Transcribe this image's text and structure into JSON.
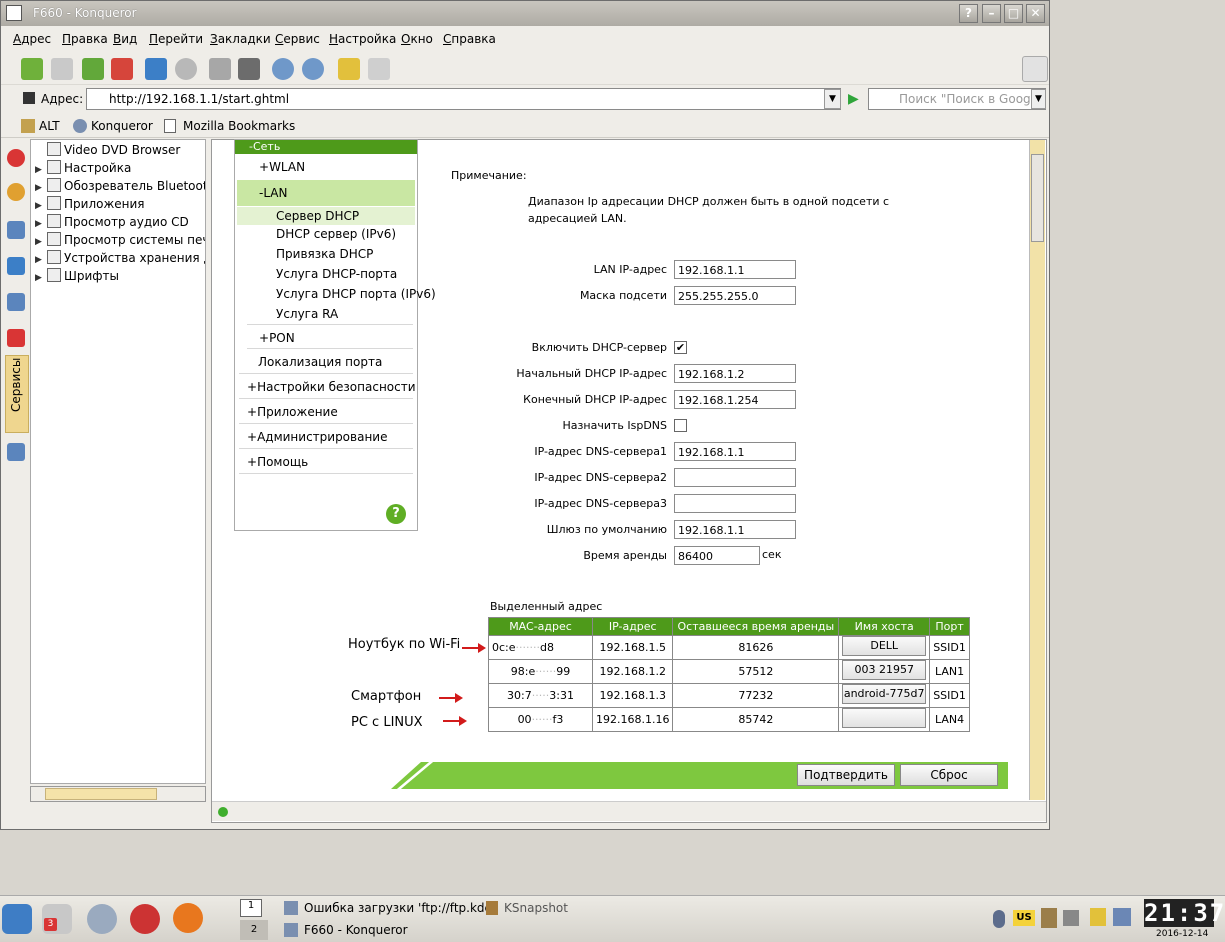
{
  "window": {
    "title": "F660 - Konqueror",
    "buttons": [
      "?",
      "–",
      "□",
      "✕"
    ]
  },
  "menu": [
    "Адрес",
    "Правка",
    "Вид",
    "Перейти",
    "Закладки",
    "Сервис",
    "Настройка",
    "Окно",
    "Справка"
  ],
  "address": {
    "label": "Адрес:",
    "url": "http://192.168.1.1/start.ghtml",
    "search_placeholder": "Поиск \"Поиск в Google\""
  },
  "bookmarks": [
    "ALT",
    "Konqueror",
    "Mozilla Bookmarks"
  ],
  "sidebar": {
    "services_tab": "Сервисы",
    "tree": [
      "Video DVD Browser",
      "Настройка",
      "Обозреватель Bluetooth",
      "Приложения",
      "Просмотр аудио CD",
      "Просмотр системы печат",
      "Устройства хранения дан",
      "Шрифты"
    ]
  },
  "router_nav": {
    "top": "-Сеть",
    "wlan": "WLAN",
    "lan": "LAN",
    "lan_items": [
      "Сервер DHCP",
      "DHCP сервер (IPv6)",
      "Привязка DHCP",
      "Услуга DHCP-порта",
      "Услуга DHCP порта (IPv6)",
      "Услуга RA"
    ],
    "pon": "PON",
    "port_loc": "Локализация порта",
    "sections": [
      "Настройки безопасности",
      "Приложение",
      "Администрирование",
      "Помощь"
    ],
    "help": "?"
  },
  "note": {
    "title": "Примечание:",
    "text": "Диапазон Ip адресации DHCP должен быть в одной подсети с адресацией LAN."
  },
  "form": {
    "lan_ip_label": "LAN IP-адрес",
    "lan_ip": "192.168.1.1",
    "mask_label": "Маска подсети",
    "mask": "255.255.255.0",
    "dhcp_enable_label": "Включить DHCP-сервер",
    "dhcp_enable_mark": "✔",
    "start_ip_label": "Начальный DHCP IP-адрес",
    "start_ip": "192.168.1.2",
    "end_ip_label": "Конечный DHCP IP-адрес",
    "end_ip": "192.168.1.254",
    "ispdns_label": "Назначить IspDNS",
    "dns1_label": "IP-адрес DNS-сервера1",
    "dns1": "192.168.1.1",
    "dns2_label": "IP-адрес DNS-сервера2",
    "dns2": "",
    "dns3_label": "IP-адрес DNS-сервера3",
    "dns3": "",
    "gateway_label": "Шлюз по умолчанию",
    "gateway": "192.168.1.1",
    "lease_label": "Время аренды",
    "lease": "86400",
    "lease_unit": "сек"
  },
  "leases": {
    "title": "Выделенный адрес",
    "headers": [
      "MAC-адрес",
      "IP-адрес",
      "Оставшееся время аренды",
      "Имя хоста",
      "Порт"
    ],
    "rows": [
      {
        "mac_a": "0c:e",
        "mac_b": "d8",
        "ip": "192.168.1.5",
        "left": "81626",
        "host": "DELL",
        "port": "SSID1"
      },
      {
        "mac_a": "98:e",
        "mac_b": "99",
        "ip": "192.168.1.2",
        "left": "57512",
        "host": "003      21957",
        "port": "LAN1"
      },
      {
        "mac_a": "30:7",
        "mac_b": "3:31",
        "ip": "192.168.1.3",
        "left": "77232",
        "host": "android-775d7",
        "port": "SSID1"
      },
      {
        "mac_a": "00",
        "mac_b": "f3",
        "ip": "192.168.1.16",
        "left": "85742",
        "host": "",
        "port": "LAN4"
      }
    ]
  },
  "annotations": {
    "wifi": "Ноутбук по Wi-Fi",
    "phone": "Смартфон",
    "pc": "PC с LINUX"
  },
  "buttons": {
    "confirm": "Подтвердить",
    "reset": "Сброс"
  },
  "taskbar": {
    "task1": "Ошибка загрузки 'ftp://ftp.kde",
    "task2": "KSnapshot",
    "task3": "F660 - Konqueror",
    "desk1": "1",
    "desk2": "2",
    "badge": "3",
    "layout": "US",
    "clock": "21:37",
    "date": "2016-12-14"
  },
  "colors": {
    "router_green": "#4e9a1a",
    "bar_green": "#7ec83f",
    "annotation_red": "#d21b1b"
  }
}
